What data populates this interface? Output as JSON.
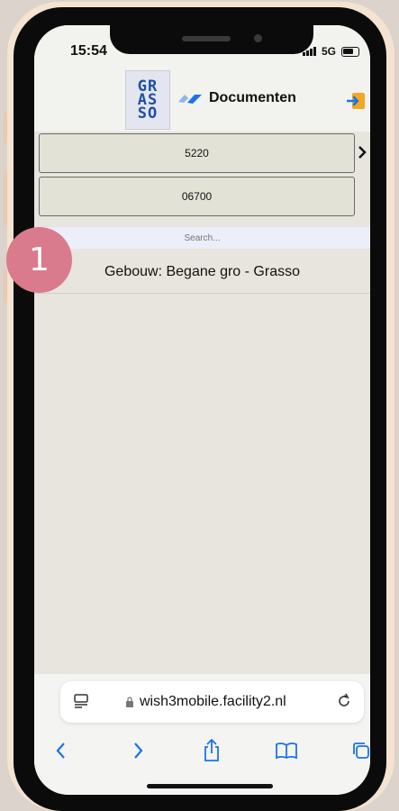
{
  "status": {
    "time": "15:54",
    "network": "5G"
  },
  "header": {
    "logo_letters": [
      "GR",
      "AS",
      "SO"
    ],
    "title": "Documenten"
  },
  "selectors": [
    {
      "value": "5220"
    },
    {
      "value": "06700"
    }
  ],
  "search": {
    "placeholder": "Search..."
  },
  "list": {
    "items": [
      {
        "label": "Gebouw: Begane gro - Grasso"
      }
    ]
  },
  "annotation": {
    "step": "1",
    "color": "#d97b8d"
  },
  "browser": {
    "url": "wish3mobile.facility2.nl"
  },
  "colors": {
    "accent_blue": "#1a73e8",
    "logout_orange": "#f5a623"
  }
}
